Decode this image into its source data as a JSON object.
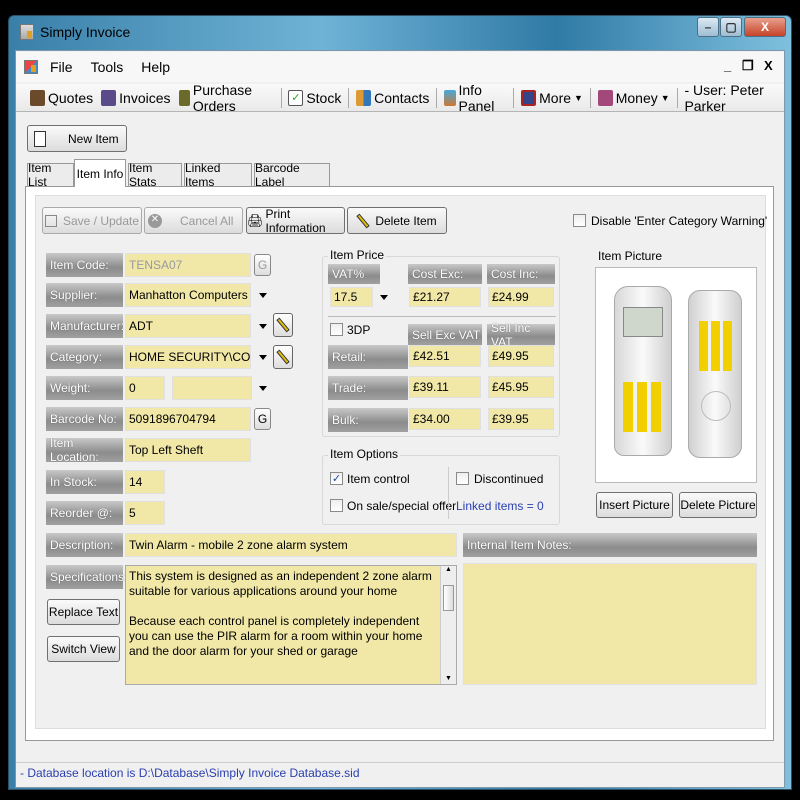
{
  "window": {
    "title": "Simply Invoice",
    "min": "–",
    "max": "▢",
    "close": "X"
  },
  "menu": {
    "items": [
      "File",
      "Tools",
      "Help"
    ],
    "mdi_min": "_",
    "mdi_restore": "❐",
    "mdi_close": "X"
  },
  "toolbar": {
    "items": [
      "Quotes",
      "Invoices",
      "Purchase Orders",
      "Stock",
      "Contacts",
      "Info Panel",
      "More",
      "Money"
    ],
    "user": "- User: Peter Parker"
  },
  "new_item": "New Item",
  "tabs": [
    "Item List",
    "Item Info",
    "Item Stats",
    "Linked Items",
    "Barcode Label"
  ],
  "actions": {
    "save": "Save / Update",
    "cancel": "Cancel All",
    "print": "Print Information",
    "delete": "Delete Item",
    "disable_warning": "Disable 'Enter Category Warning'"
  },
  "fields": {
    "item_code": {
      "label": "Item Code:",
      "value": "TENSA07"
    },
    "supplier": {
      "label": "Supplier:",
      "value": "Manhatton Computers"
    },
    "manufacturer": {
      "label": "Manufacturer:",
      "value": "ADT"
    },
    "category": {
      "label": "Category:",
      "value": "HOME SECURITY\\CONTF"
    },
    "weight": {
      "label": "Weight:",
      "value": "0",
      "unit": ""
    },
    "barcode": {
      "label": "Barcode No:",
      "value": "5091896704794"
    },
    "location": {
      "label": "Item Location:",
      "value": "Top Left Sheft"
    },
    "in_stock": {
      "label": "In Stock:",
      "value": "14"
    },
    "reorder": {
      "label": "Reorder @:",
      "value": "5"
    },
    "g_label": "G"
  },
  "price": {
    "title": "Item Price",
    "vat_label": "VAT%",
    "vat": "17.5",
    "cost_exc_label": "Cost Exc:",
    "cost_exc": "£21.27",
    "cost_inc_label": "Cost Inc:",
    "cost_inc": "£24.99",
    "threedp": "3DP",
    "sell_exc_label": "Sell Exc VAT",
    "sell_inc_label": "Sell Inc VAT",
    "rows": [
      {
        "label": "Retail:",
        "exc": "£42.51",
        "inc": "£49.95"
      },
      {
        "label": "Trade:",
        "exc": "£39.11",
        "inc": "£45.95"
      },
      {
        "label": "Bulk:",
        "exc": "£34.00",
        "inc": "£39.95"
      }
    ]
  },
  "options": {
    "title": "Item Options",
    "item_control": "Item control",
    "item_control_checked": true,
    "on_sale": "On sale/special offer",
    "discontinued": "Discontinued",
    "linked": "Linked items = 0"
  },
  "picture": {
    "title": "Item Picture",
    "insert": "Insert Picture",
    "delete": "Delete Picture"
  },
  "description": {
    "label": "Description:",
    "value": "Twin Alarm - mobile 2 zone alarm system"
  },
  "notes": {
    "label": "Internal Item Notes:",
    "value": ""
  },
  "specs": {
    "label": "Specifications:",
    "p1": "This system is designed as an independent 2 zone alarm suitable for various applications around your home",
    "p2": "Because each control panel is completely independent you can use the PIR alarm for a room within your home and the door alarm for your shed or garage",
    "replace": "Replace Text",
    "switch": "Switch View"
  },
  "status": "- Database location is D:\\Database\\Simply Invoice Database.sid",
  "colors": {
    "field": "#f1e8a8",
    "link": "#2a3fb0"
  }
}
